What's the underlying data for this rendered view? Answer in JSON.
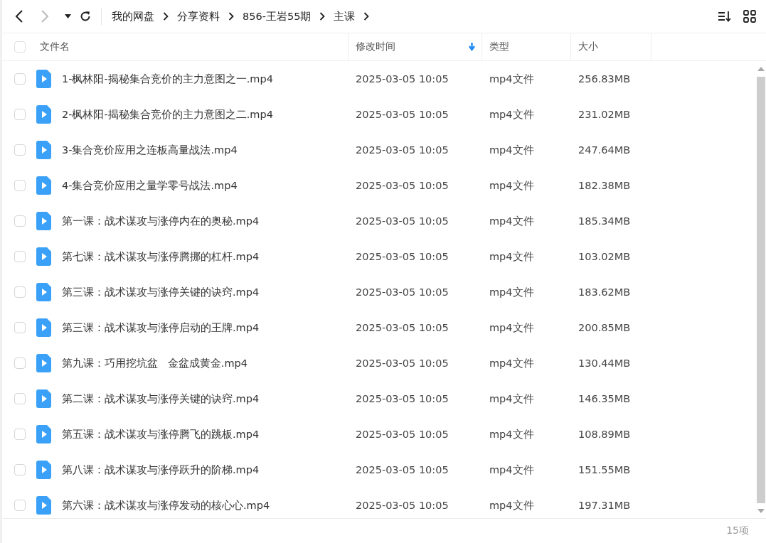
{
  "toolbar": {
    "back": {
      "disabled": false
    },
    "forward": {
      "disabled": true
    },
    "breadcrumbs": [
      "我的网盘",
      "分享资料",
      "856-王岩55期",
      "主课"
    ]
  },
  "table": {
    "select_all": {
      "checked": false
    },
    "columns": [
      {
        "label": "文件名",
        "sorted": false
      },
      {
        "label": "修改时间",
        "sorted": true
      },
      {
        "label": "类型",
        "sorted": false
      },
      {
        "label": "大小",
        "sorted": false
      }
    ],
    "rows": [
      {
        "checked": false,
        "name": "1-枫林阳-揭秘集合竞价的主力意图之一.mp4",
        "modified": "2025-03-05 10:05",
        "type": "mp4文件",
        "size": "256.83MB"
      },
      {
        "checked": false,
        "name": "2-枫林阳-揭秘集合竞价的主力意图之二.mp4",
        "modified": "2025-03-05 10:05",
        "type": "mp4文件",
        "size": "231.02MB"
      },
      {
        "checked": false,
        "name": "3-集合竞价应用之连板高量战法.mp4",
        "modified": "2025-03-05 10:05",
        "type": "mp4文件",
        "size": "247.64MB"
      },
      {
        "checked": false,
        "name": "4-集合竞价应用之量学零号战法.mp4",
        "modified": "2025-03-05 10:05",
        "type": "mp4文件",
        "size": "182.38MB"
      },
      {
        "checked": false,
        "name": "第一课：战术谋攻与涨停内在的奥秘.mp4",
        "modified": "2025-03-05 10:05",
        "type": "mp4文件",
        "size": "185.34MB"
      },
      {
        "checked": false,
        "name": "第七课：战术谋攻与涨停腾挪的杠杆.mp4",
        "modified": "2025-03-05 10:05",
        "type": "mp4文件",
        "size": "103.02MB"
      },
      {
        "checked": false,
        "name": "第三课：战术谋攻与涨停关键的诀窍.mp4",
        "modified": "2025-03-05 10:05",
        "type": "mp4文件",
        "size": "183.62MB"
      },
      {
        "checked": false,
        "name": "第三课：战术谋攻与涨停启动的王牌.mp4",
        "modified": "2025-03-05 10:05",
        "type": "mp4文件",
        "size": "200.85MB"
      },
      {
        "checked": false,
        "name": "第九课：巧用挖坑盆   金盆成黄金.mp4",
        "modified": "2025-03-05 10:05",
        "type": "mp4文件",
        "size": "130.44MB"
      },
      {
        "checked": false,
        "name": "第二课：战术谋攻与涨停关键的诀窍.mp4",
        "modified": "2025-03-05 10:05",
        "type": "mp4文件",
        "size": "146.35MB"
      },
      {
        "checked": false,
        "name": "第五课：战术谋攻与涨停腾飞的跳板.mp4",
        "modified": "2025-03-05 10:05",
        "type": "mp4文件",
        "size": "108.89MB"
      },
      {
        "checked": false,
        "name": "第八课：战术谋攻与涨停跃升的阶梯.mp4",
        "modified": "2025-03-05 10:05",
        "type": "mp4文件",
        "size": "151.55MB"
      },
      {
        "checked": false,
        "name": "第六课：战术谋攻与涨停发动的核心心.mp4",
        "modified": "2025-03-05 10:05",
        "type": "mp4文件",
        "size": "197.31MB"
      }
    ]
  },
  "status_bar": {
    "count": "15项"
  }
}
